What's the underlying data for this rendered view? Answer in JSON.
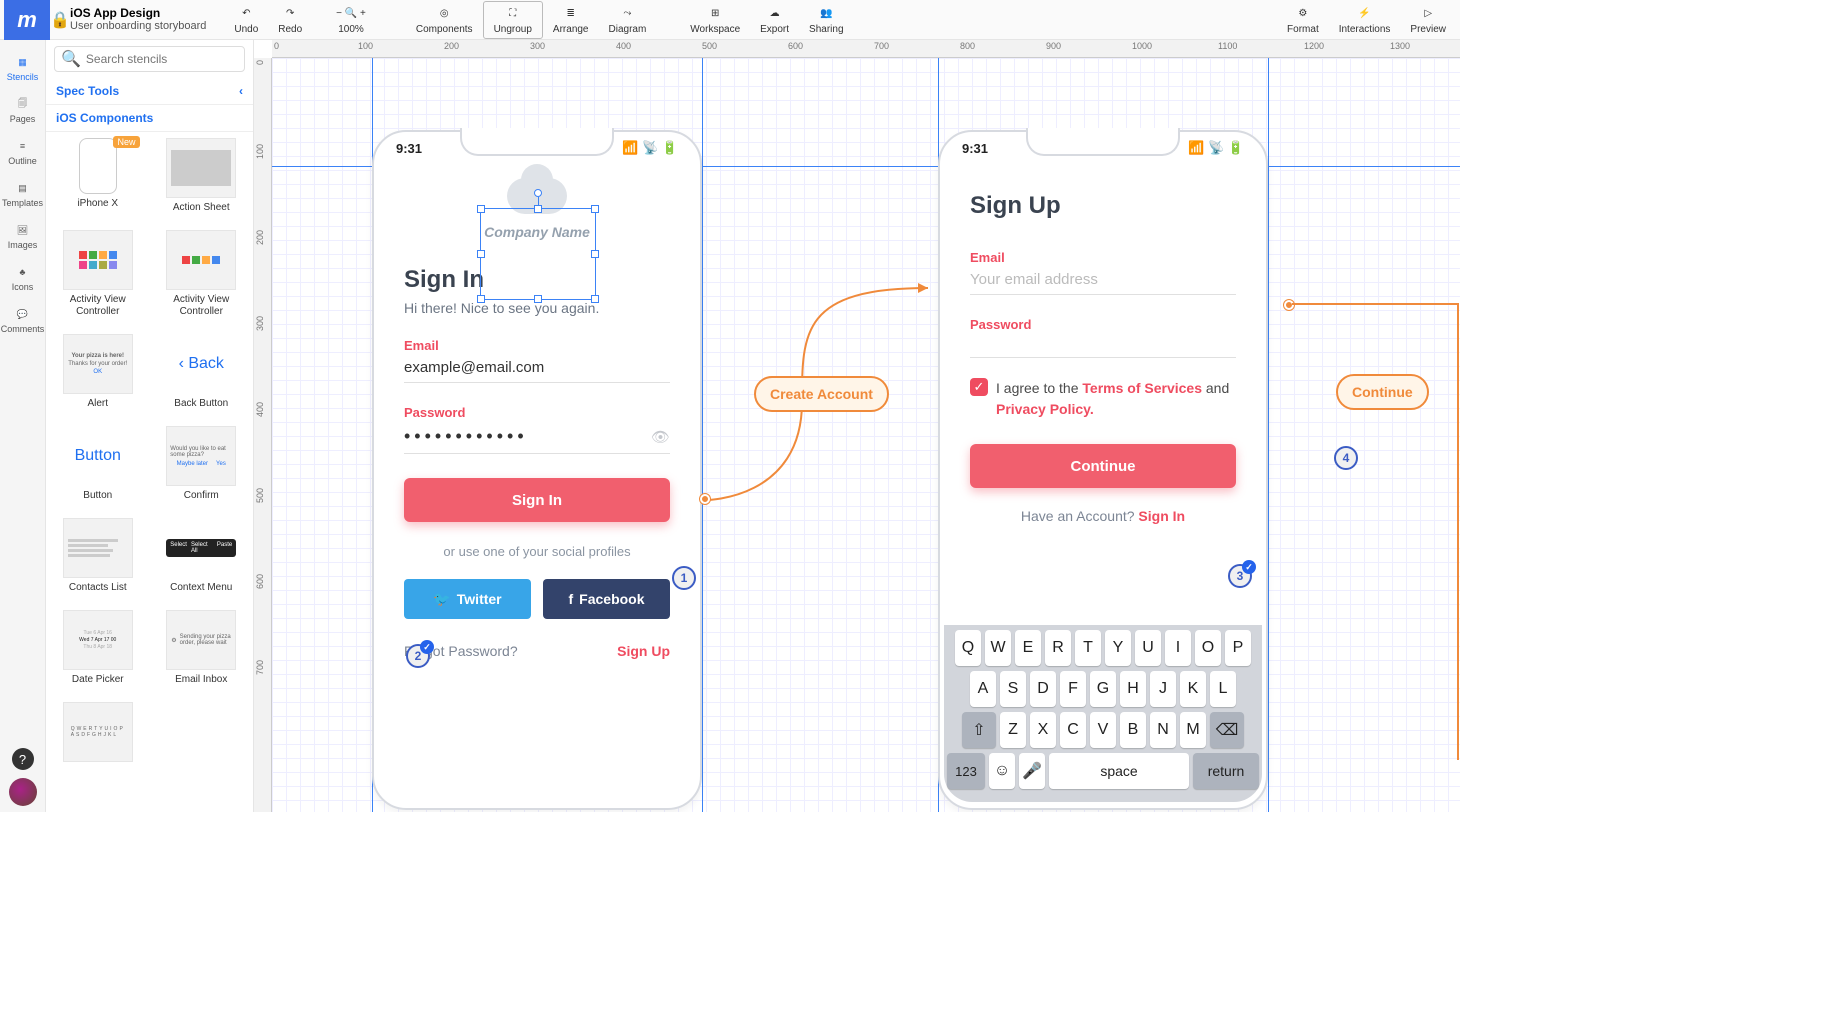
{
  "app": {
    "logo": "m",
    "project_title": "iOS App Design",
    "project_subtitle": "User onboarding storyboard"
  },
  "toolbar": {
    "undo": "Undo",
    "redo": "Redo",
    "zoom": "100%",
    "components": "Components",
    "ungroup": "Ungroup",
    "arrange": "Arrange",
    "diagram": "Diagram",
    "workspace": "Workspace",
    "export": "Export",
    "sharing": "Sharing",
    "format": "Format",
    "interactions": "Interactions",
    "preview": "Preview"
  },
  "rail": {
    "stencils": "Stencils",
    "pages": "Pages",
    "outline": "Outline",
    "templates": "Templates",
    "images": "Images",
    "icons": "Icons",
    "comments": "Comments"
  },
  "sidebar": {
    "search_placeholder": "Search stencils",
    "spec_tools": "Spec Tools",
    "ios_components": "iOS Components",
    "new_badge": "New",
    "back_label": "Back",
    "button_label": "Button",
    "stencils": [
      "iPhone X",
      "Action Sheet",
      "Activity View Controller",
      "Activity View Controller",
      "Alert",
      "Back Button",
      "Button",
      "Confirm",
      "Contacts List",
      "Context Menu",
      "Date Picker",
      "Email Inbox"
    ],
    "alert_thumb": {
      "l1": "Your pizza is here!",
      "l2": "Thanks for your order!",
      "ok": "OK"
    },
    "confirm_thumb": {
      "q": "Would you like to eat some pizza?",
      "no": "Maybe later",
      "yes": "Yes"
    },
    "context_thumb": {
      "a": "Select",
      "b": "Select All",
      "c": "Paste"
    },
    "emailinbox_thumb": "Sending your pizza order, please wait"
  },
  "ruler": {
    "h": [
      "0",
      "100",
      "200",
      "300",
      "400",
      "500",
      "600",
      "700",
      "800",
      "900",
      "1000",
      "1100",
      "1200",
      "1300"
    ],
    "v": [
      "0",
      "100",
      "200",
      "300",
      "400",
      "500",
      "600",
      "700"
    ]
  },
  "signin": {
    "time": "9:31",
    "company": "Company Name",
    "heading": "Sign In",
    "subtitle": "Hi there! Nice to see you again.",
    "email_label": "Email",
    "email_value": "example@email.com",
    "password_label": "Password",
    "password_value": "••••••••••••",
    "button": "Sign In",
    "or_text": "or use one of your social profiles",
    "twitter": "Twitter",
    "facebook": "Facebook",
    "forgot": "Forgot Password?",
    "signup": "Sign Up"
  },
  "signup": {
    "time": "9:31",
    "heading": "Sign Up",
    "email_label": "Email",
    "email_placeholder": "Your email address",
    "password_label": "Password",
    "agree_prefix": "I agree to the ",
    "tos": "Terms of Services",
    "and": " and ",
    "pp": "Privacy Policy.",
    "button": "Continue",
    "have": "Have an Account?  ",
    "signin": "Sign In"
  },
  "keyboard": {
    "r1": [
      "Q",
      "W",
      "E",
      "R",
      "T",
      "Y",
      "U",
      "I",
      "O",
      "P"
    ],
    "r2": [
      "A",
      "S",
      "D",
      "F",
      "G",
      "H",
      "J",
      "K",
      "L"
    ],
    "r3": [
      "Z",
      "X",
      "C",
      "V",
      "B",
      "N",
      "M"
    ],
    "num": "123",
    "space": "space",
    "return": "return"
  },
  "flow": {
    "create_account": "Create Account",
    "continue": "Continue"
  },
  "comments": {
    "c1": "1",
    "c2": "2",
    "c3": "3",
    "c4": "4"
  }
}
